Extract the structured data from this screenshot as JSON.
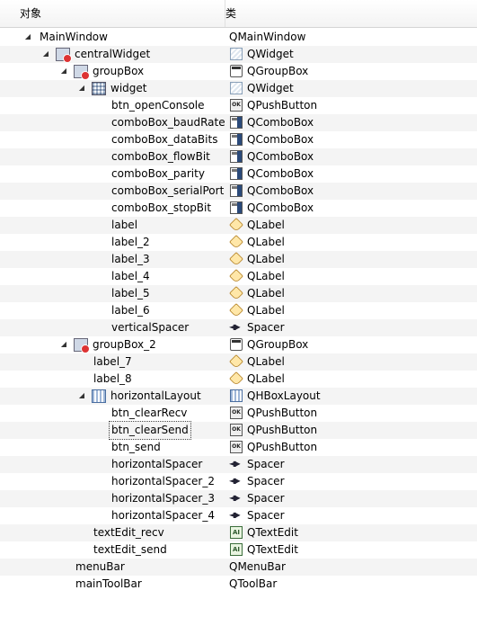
{
  "header": {
    "col_object": "对象",
    "col_class": "类"
  },
  "icons": {
    "container": "container-widget-icon",
    "widget": "widget-icon",
    "groupbox": "groupbox-icon",
    "pushbutton": "pushbutton-icon",
    "combobox": "combobox-icon",
    "label": "label-icon",
    "spacer": "spacer-icon",
    "hbox": "hboxlayout-icon",
    "textedit": "textedit-icon",
    "layout": "layout-icon"
  },
  "rows": [
    {
      "name": "MainWindow",
      "type": "QMainWindow",
      "depth": 0,
      "arrow": "expanded",
      "node_icon": null,
      "type_icon": null
    },
    {
      "name": "centralWidget",
      "type": "QWidget",
      "depth": 1,
      "arrow": "expanded",
      "node_icon": "container",
      "type_icon": "widget"
    },
    {
      "name": "groupBox",
      "type": "QGroupBox",
      "depth": 2,
      "arrow": "expanded",
      "node_icon": "container",
      "type_icon": "groupbox"
    },
    {
      "name": "widget",
      "type": "QWidget",
      "depth": 3,
      "arrow": "expanded",
      "node_icon": "layout",
      "type_icon": "widget"
    },
    {
      "name": "btn_openConsole",
      "type": "QPushButton",
      "depth": 4,
      "arrow": null,
      "node_icon": null,
      "type_icon": "pushbutton"
    },
    {
      "name": "comboBox_baudRate",
      "type": "QComboBox",
      "depth": 4,
      "arrow": null,
      "node_icon": null,
      "type_icon": "combobox"
    },
    {
      "name": "comboBox_dataBits",
      "type": "QComboBox",
      "depth": 4,
      "arrow": null,
      "node_icon": null,
      "type_icon": "combobox"
    },
    {
      "name": "comboBox_flowBit",
      "type": "QComboBox",
      "depth": 4,
      "arrow": null,
      "node_icon": null,
      "type_icon": "combobox"
    },
    {
      "name": "comboBox_parity",
      "type": "QComboBox",
      "depth": 4,
      "arrow": null,
      "node_icon": null,
      "type_icon": "combobox"
    },
    {
      "name": "comboBox_serialPort",
      "type": "QComboBox",
      "depth": 4,
      "arrow": null,
      "node_icon": null,
      "type_icon": "combobox"
    },
    {
      "name": "comboBox_stopBit",
      "type": "QComboBox",
      "depth": 4,
      "arrow": null,
      "node_icon": null,
      "type_icon": "combobox"
    },
    {
      "name": "label",
      "type": "QLabel",
      "depth": 4,
      "arrow": null,
      "node_icon": null,
      "type_icon": "label"
    },
    {
      "name": "label_2",
      "type": "QLabel",
      "depth": 4,
      "arrow": null,
      "node_icon": null,
      "type_icon": "label"
    },
    {
      "name": "label_3",
      "type": "QLabel",
      "depth": 4,
      "arrow": null,
      "node_icon": null,
      "type_icon": "label"
    },
    {
      "name": "label_4",
      "type": "QLabel",
      "depth": 4,
      "arrow": null,
      "node_icon": null,
      "type_icon": "label"
    },
    {
      "name": "label_5",
      "type": "QLabel",
      "depth": 4,
      "arrow": null,
      "node_icon": null,
      "type_icon": "label"
    },
    {
      "name": "label_6",
      "type": "QLabel",
      "depth": 4,
      "arrow": null,
      "node_icon": null,
      "type_icon": "label"
    },
    {
      "name": "verticalSpacer",
      "type": "Spacer",
      "depth": 4,
      "arrow": null,
      "node_icon": null,
      "type_icon": "spacer"
    },
    {
      "name": "groupBox_2",
      "type": "QGroupBox",
      "depth": 2,
      "arrow": "expanded",
      "node_icon": "container",
      "type_icon": "groupbox"
    },
    {
      "name": "label_7",
      "type": "QLabel",
      "depth": 3,
      "arrow": null,
      "node_icon": null,
      "type_icon": "label"
    },
    {
      "name": "label_8",
      "type": "QLabel",
      "depth": 3,
      "arrow": null,
      "node_icon": null,
      "type_icon": "label"
    },
    {
      "name": "horizontalLayout",
      "type": "QHBoxLayout",
      "depth": 3,
      "arrow": "expanded",
      "node_icon": "hbox",
      "type_icon": "hbox"
    },
    {
      "name": "btn_clearRecv",
      "type": "QPushButton",
      "depth": 4,
      "arrow": null,
      "node_icon": null,
      "type_icon": "pushbutton"
    },
    {
      "name": "btn_clearSend",
      "type": "QPushButton",
      "depth": 4,
      "arrow": null,
      "node_icon": null,
      "type_icon": "pushbutton",
      "selected": true
    },
    {
      "name": "btn_send",
      "type": "QPushButton",
      "depth": 4,
      "arrow": null,
      "node_icon": null,
      "type_icon": "pushbutton"
    },
    {
      "name": "horizontalSpacer",
      "type": "Spacer",
      "depth": 4,
      "arrow": null,
      "node_icon": null,
      "type_icon": "spacer"
    },
    {
      "name": "horizontalSpacer_2",
      "type": "Spacer",
      "depth": 4,
      "arrow": null,
      "node_icon": null,
      "type_icon": "spacer"
    },
    {
      "name": "horizontalSpacer_3",
      "type": "Spacer",
      "depth": 4,
      "arrow": null,
      "node_icon": null,
      "type_icon": "spacer"
    },
    {
      "name": "horizontalSpacer_4",
      "type": "Spacer",
      "depth": 4,
      "arrow": null,
      "node_icon": null,
      "type_icon": "spacer"
    },
    {
      "name": "textEdit_recv",
      "type": "QTextEdit",
      "depth": 3,
      "arrow": null,
      "node_icon": null,
      "type_icon": "textedit"
    },
    {
      "name": "textEdit_send",
      "type": "QTextEdit",
      "depth": 3,
      "arrow": null,
      "node_icon": null,
      "type_icon": "textedit"
    },
    {
      "name": "menuBar",
      "type": "QMenuBar",
      "depth": 2,
      "arrow": null,
      "node_icon": null,
      "type_icon": null
    },
    {
      "name": "mainToolBar",
      "type": "QToolBar",
      "depth": 2,
      "arrow": null,
      "node_icon": null,
      "type_icon": null
    }
  ],
  "colors": {
    "alt_row": "#f4f4f4",
    "text": "#000000"
  }
}
